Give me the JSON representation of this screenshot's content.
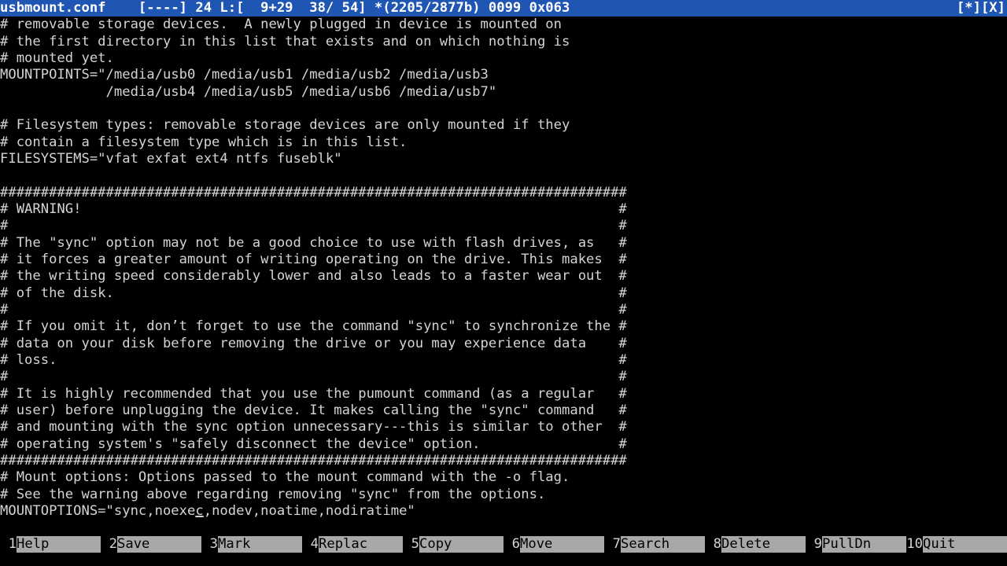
{
  "status": {
    "filename": "usbmount.conf",
    "info": "    [----] 24 L:[  9+29  38/ 54] *(2205/2877b) 0099 0x063",
    "flags": "[*][X]",
    "background": "#1f56b3"
  },
  "editor": {
    "lines": [
      "# removable storage devices.  A newly plugged in device is mounted on",
      "# the first directory in this list that exists and on which nothing is",
      "# mounted yet.",
      "MOUNTPOINTS=\"/media/usb0 /media/usb1 /media/usb2 /media/usb3",
      "             /media/usb4 /media/usb5 /media/usb6 /media/usb7\"",
      "",
      "# Filesystem types: removable storage devices are only mounted if they",
      "# contain a filesystem type which is in this list.",
      "FILESYSTEMS=\"vfat exfat ext4 ntfs fuseblk\"",
      "",
      "#############################################################################",
      "# WARNING!                                                                  #",
      "#                                                                           #",
      "# The \"sync\" option may not be a good choice to use with flash drives, as   #",
      "# it forces a greater amount of writing operating on the drive. This makes  #",
      "# the writing speed considerably lower and also leads to a faster wear out  #",
      "# of the disk.                                                              #",
      "#                                                                           #",
      "# If you omit it, don’t forget to use the command \"sync\" to synchronize the #",
      "# data on your disk before removing the drive or you may experience data    #",
      "# loss.                                                                     #",
      "#                                                                           #",
      "# It is highly recommended that you use the pumount command (as a regular   #",
      "# user) before unplugging the device. It makes calling the \"sync\" command   #",
      "# and mounting with the sync option unnecessary---this is similar to other  #",
      "# operating system's \"safely disconnect the device\" option.                 #",
      "#############################################################################",
      "# Mount options: Options passed to the mount command with the -o flag.",
      "# See the warning above regarding removing \"sync\" from the options."
    ],
    "cursor_line": {
      "before": "MOUNTOPTIONS=\"sync,noexe",
      "cursor_char": "c",
      "after": ",nodev,noatime,nodiratime\""
    }
  },
  "fkeys": [
    {
      "num": "1",
      "label": "Help"
    },
    {
      "num": "2",
      "label": "Save"
    },
    {
      "num": "3",
      "label": "Mark"
    },
    {
      "num": "4",
      "label": "Replac"
    },
    {
      "num": "5",
      "label": "Copy"
    },
    {
      "num": "6",
      "label": "Move"
    },
    {
      "num": "7",
      "label": "Search"
    },
    {
      "num": "8",
      "label": "Delete"
    },
    {
      "num": "9",
      "label": "PullDn"
    },
    {
      "num": "10",
      "label": "Quit"
    }
  ]
}
